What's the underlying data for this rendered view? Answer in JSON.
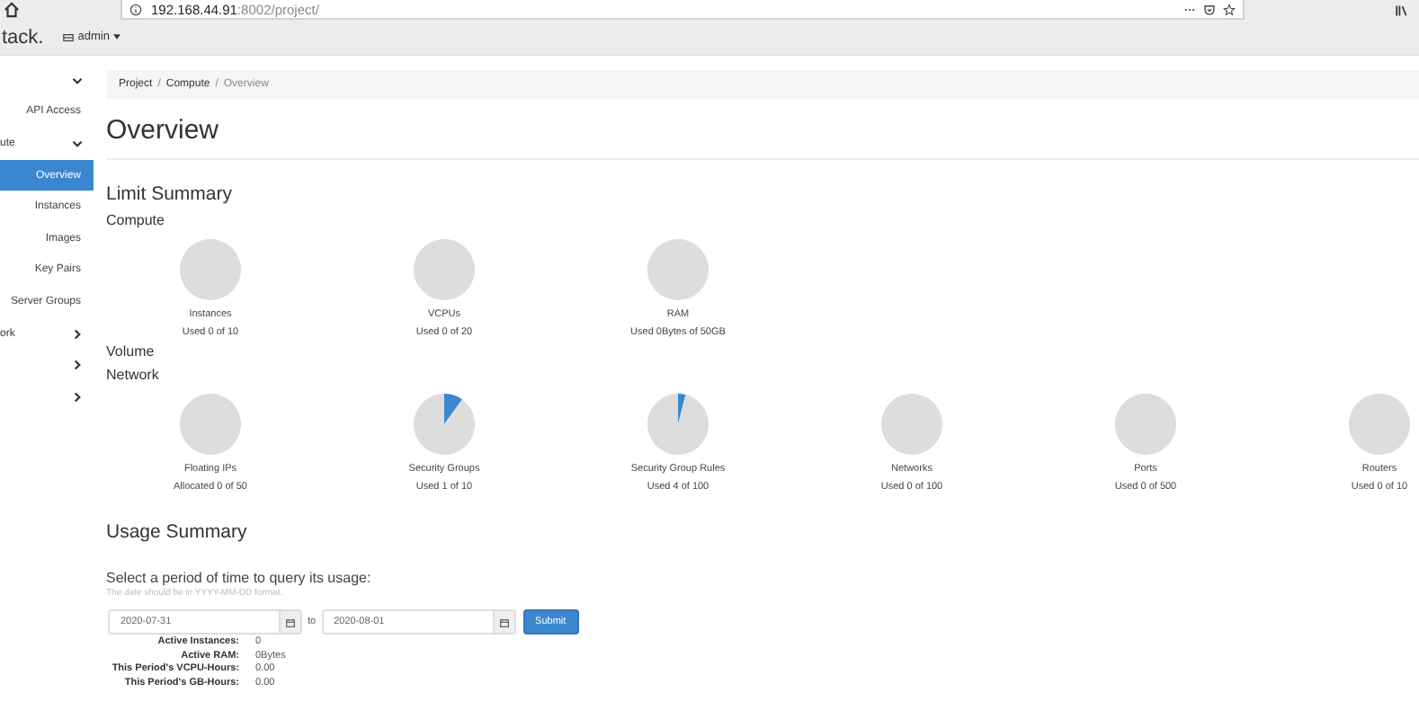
{
  "browser": {
    "url_host": "192.168.44.91",
    "url_rest": ":8002/project/"
  },
  "header": {
    "logo": "tack.",
    "project_menu": "admin"
  },
  "sidebar": {
    "items": [
      {
        "kind": "group",
        "expanded": true
      },
      {
        "kind": "link",
        "label": "API Access",
        "selected": false
      },
      {
        "kind": "group",
        "label": "ute",
        "expanded": true
      },
      {
        "kind": "link",
        "label": "Overview",
        "selected": true
      },
      {
        "kind": "link",
        "label": "Instances",
        "selected": false
      },
      {
        "kind": "link",
        "label": "Images",
        "selected": false
      },
      {
        "kind": "link",
        "label": "Key Pairs",
        "selected": false
      },
      {
        "kind": "link",
        "label": "Server Groups",
        "selected": false
      },
      {
        "kind": "group",
        "label": "ork",
        "expanded": false
      },
      {
        "kind": "group",
        "expanded": false
      },
      {
        "kind": "group",
        "expanded": false
      }
    ]
  },
  "breadcrumb": [
    "Project",
    "Compute",
    "Overview"
  ],
  "breadcrumb_separator": "/",
  "title": "Overview",
  "limit_summary": {
    "title": "Limit Summary",
    "groups": [
      {
        "title": "Compute",
        "pies": [
          {
            "name": "Instances",
            "usage": "Used 0 of 10",
            "chart_data": {
              "type": "pie",
              "values": [
                0,
                100
              ]
            }
          },
          {
            "name": "VCPUs",
            "usage": "Used 0 of 20",
            "chart_data": {
              "type": "pie",
              "values": [
                0,
                100
              ]
            }
          },
          {
            "name": "RAM",
            "usage": "Used 0Bytes of 50GB",
            "chart_data": {
              "type": "pie",
              "values": [
                0,
                100
              ]
            }
          }
        ]
      },
      {
        "title": "Volume"
      },
      {
        "title": "Network",
        "pies": [
          {
            "name": "Floating IPs",
            "usage": "Allocated 0 of 50",
            "chart_data": {
              "type": "pie",
              "values": [
                0,
                100
              ]
            }
          },
          {
            "name": "Security Groups",
            "usage": "Used 1 of 10",
            "chart_data": {
              "type": "pie",
              "values": [
                10,
                90
              ]
            }
          },
          {
            "name": "Security Group Rules",
            "usage": "Used 4 of 100",
            "chart_data": {
              "type": "pie",
              "values": [
                4,
                96
              ]
            }
          },
          {
            "name": "Networks",
            "usage": "Used 0 of 100",
            "chart_data": {
              "type": "pie",
              "values": [
                0,
                100
              ]
            }
          },
          {
            "name": "Ports",
            "usage": "Used 0 of 500",
            "chart_data": {
              "type": "pie",
              "values": [
                0,
                100
              ]
            }
          },
          {
            "name": "Routers",
            "usage": "Used 0 of 10",
            "chart_data": {
              "type": "pie",
              "values": [
                0,
                100
              ]
            }
          }
        ]
      }
    ]
  },
  "usage_summary": {
    "title": "Usage Summary",
    "prompt": "Select a period of time to query its usage:",
    "hint": "The date should be in YYYY-MM-DD format.",
    "start": "2020-07-31",
    "to": "to",
    "end": "2020-08-01",
    "submit": "Submit",
    "stats": [
      {
        "label": "Active Instances:",
        "value": "0"
      },
      {
        "label": "Active RAM:",
        "value": "0Bytes"
      },
      {
        "label": "This Period's VCPU-Hours:",
        "value": "0.00"
      },
      {
        "label": "This Period's GB-Hours:",
        "value": "0.00"
      }
    ]
  }
}
